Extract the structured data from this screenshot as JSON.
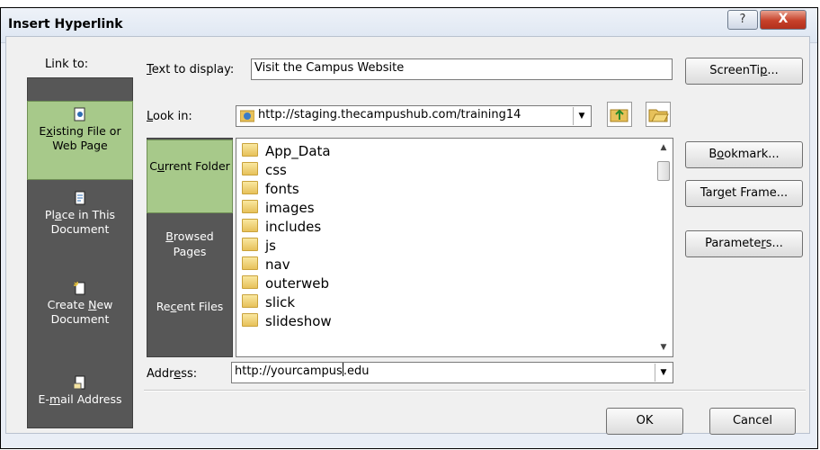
{
  "dialog": {
    "title": "Insert Hyperlink",
    "help_label": "?",
    "close_label": "X"
  },
  "link_to": {
    "label": "Link to:",
    "items": [
      {
        "pre": "",
        "u": "x",
        "post": "isting File or Web Page",
        "prefix": "E"
      },
      {
        "prefix": "Pl",
        "u": "a",
        "post": "ce in This Document"
      },
      {
        "prefix": "Create ",
        "u": "N",
        "post": "ew Document"
      },
      {
        "prefix": "E-",
        "u": "m",
        "post": "ail Address"
      }
    ]
  },
  "text_display": {
    "label_u": "T",
    "label_rest": "ext to display:",
    "value": "Visit the Campus Website"
  },
  "look_in": {
    "label_u": "L",
    "label_rest": "ook in:",
    "value": "http://staging.thecampushub.com/training14"
  },
  "sub_nav": [
    {
      "prefix": "C",
      "u": "u",
      "post": "rrent Folder"
    },
    {
      "prefix": "",
      "u": "B",
      "post": "rowsed Pages"
    },
    {
      "prefix": "Re",
      "u": "c",
      "post": "ent Files"
    }
  ],
  "files": [
    "App_Data",
    "css",
    "fonts",
    "images",
    "includes",
    "js",
    "nav",
    "outerweb",
    "slick",
    "slideshow"
  ],
  "address": {
    "label_pre": "Addr",
    "label_u": "e",
    "label_post": "ss:",
    "value_before_cursor": "http://yourcampus",
    "value_after_cursor": ".edu"
  },
  "buttons": {
    "screentip": {
      "pre": "ScreenTi",
      "u": "p",
      "post": "..."
    },
    "bookmark": {
      "pre": "B",
      "u": "o",
      "post": "okmark..."
    },
    "target_frame": {
      "pre": "Tar",
      "u": "g",
      "post": "et Frame..."
    },
    "parameters": {
      "pre": "Paramete",
      "u": "r",
      "post": "s..."
    },
    "ok": "OK",
    "cancel": "Cancel"
  }
}
